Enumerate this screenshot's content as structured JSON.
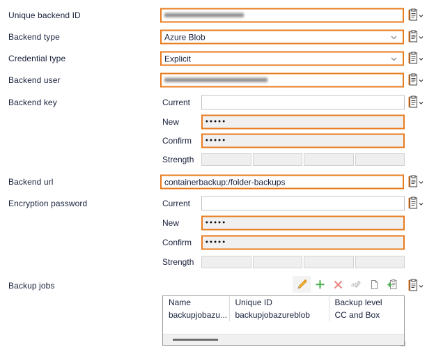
{
  "theme": {
    "accent": "#e87b1e",
    "text": "#17203a",
    "field_border": "#ababab",
    "pw_background": "#f0f0f0",
    "add_icon_color": "#4caf50",
    "delete_icon_color": "#e8837f",
    "edit_icon_color": "#f0a830"
  },
  "rows": {
    "unique_backend_id": {
      "label": "Unique backend ID",
      "value": "",
      "redacted": true
    },
    "backend_type": {
      "label": "Backend type",
      "value": "Azure Blob"
    },
    "credential_type": {
      "label": "Credential type",
      "value": "Explicit"
    },
    "backend_user": {
      "label": "Backend user",
      "value": "",
      "redacted": true
    },
    "backend_key": {
      "label": "Backend key",
      "current_label": "Current",
      "current_value": "",
      "new_label": "New",
      "new_value": "•••••",
      "confirm_label": "Confirm",
      "confirm_value": "•••••",
      "strength_label": "Strength",
      "strength_segments": 4,
      "strength_filled": 0
    },
    "backend_url": {
      "label": "Backend url",
      "value": "containerbackup:/folder-backups"
    },
    "encryption_password": {
      "label": "Encryption password",
      "current_label": "Current",
      "current_value": "",
      "new_label": "New",
      "new_value": "•••••",
      "confirm_label": "Confirm",
      "confirm_value": "•••••",
      "strength_label": "Strength",
      "strength_segments": 4,
      "strength_filled": 0
    },
    "backup_jobs": {
      "label": "Backup jobs"
    }
  },
  "toolbar": {
    "edit": "edit-icon",
    "add": "add-icon",
    "delete": "delete-icon",
    "rename": "rename-icon",
    "copy": "copy-icon",
    "paste": "paste-icon"
  },
  "clipboard_icon": "clipboard-dropdown-icon",
  "dropdown_icon": "chevron-down-icon",
  "table": {
    "columns": [
      "Name",
      "Unique ID",
      "Backup level"
    ],
    "rows": [
      [
        "backupjobazu...",
        "backupjobazureblob",
        "CC and Box"
      ]
    ]
  }
}
